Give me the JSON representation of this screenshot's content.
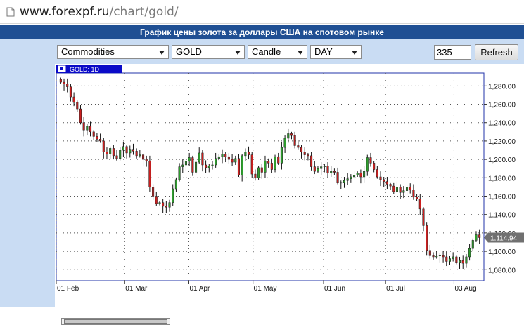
{
  "browser": {
    "url_host": "www.forexpf.ru",
    "url_path": "/chart/gold/"
  },
  "panel": {
    "title": "График цены золота за доллары США на спотовом рынке"
  },
  "controls": {
    "market": "Commodities",
    "symbol": "GOLD",
    "chart_type": "Candle",
    "period": "DAY",
    "bars": "335",
    "refresh_label": "Refresh"
  },
  "chart_data": {
    "type": "candlestick",
    "legend": "GOLD: 1D",
    "last_price_label": "1,114.94",
    "last_price": 1114.94,
    "y_ticks": [
      "1,280.00",
      "1,260.00",
      "1,240.00",
      "1,220.00",
      "1,200.00",
      "1,180.00",
      "1,160.00",
      "1,140.00",
      "1,120.00",
      "1,100.00",
      "1,080.00"
    ],
    "x_ticks": [
      "01 Feb",
      "01 Mar",
      "01 Apr",
      "01 May",
      "01 Jun",
      "01 Jul",
      "03 Aug"
    ],
    "ylim": [
      1068,
      1294
    ],
    "colors": {
      "up": "#2e9e2e",
      "down": "#cc1f1f",
      "grid": "#555555",
      "legend_bg": "#0a0ac8"
    },
    "close_series": [
      1284,
      1282,
      1279,
      1268,
      1262,
      1255,
      1240,
      1232,
      1236,
      1230,
      1225,
      1222,
      1220,
      1208,
      1206,
      1212,
      1204,
      1201,
      1210,
      1214,
      1207,
      1211,
      1209,
      1204,
      1205,
      1200,
      1198,
      1170,
      1160,
      1152,
      1153,
      1149,
      1148,
      1153,
      1168,
      1178,
      1192,
      1194,
      1198,
      1202,
      1186,
      1197,
      1207,
      1194,
      1191,
      1193,
      1194,
      1201,
      1203,
      1206,
      1203,
      1200,
      1197,
      1201,
      1183,
      1204,
      1208,
      1205,
      1184,
      1180,
      1191,
      1186,
      1198,
      1196,
      1189,
      1203,
      1196,
      1213,
      1223,
      1228,
      1226,
      1215,
      1213,
      1208,
      1205,
      1204,
      1192,
      1187,
      1190,
      1192,
      1193,
      1185,
      1187,
      1186,
      1175,
      1175,
      1177,
      1179,
      1181,
      1183,
      1185,
      1181,
      1187,
      1202,
      1196,
      1189,
      1181,
      1178,
      1176,
      1173,
      1171,
      1165,
      1170,
      1164,
      1166,
      1170,
      1167,
      1159,
      1157,
      1146,
      1128,
      1101,
      1096,
      1094,
      1095,
      1096,
      1094,
      1089,
      1092,
      1094,
      1088,
      1090,
      1087,
      1094,
      1103,
      1112,
      1118,
      1114.94
    ]
  }
}
